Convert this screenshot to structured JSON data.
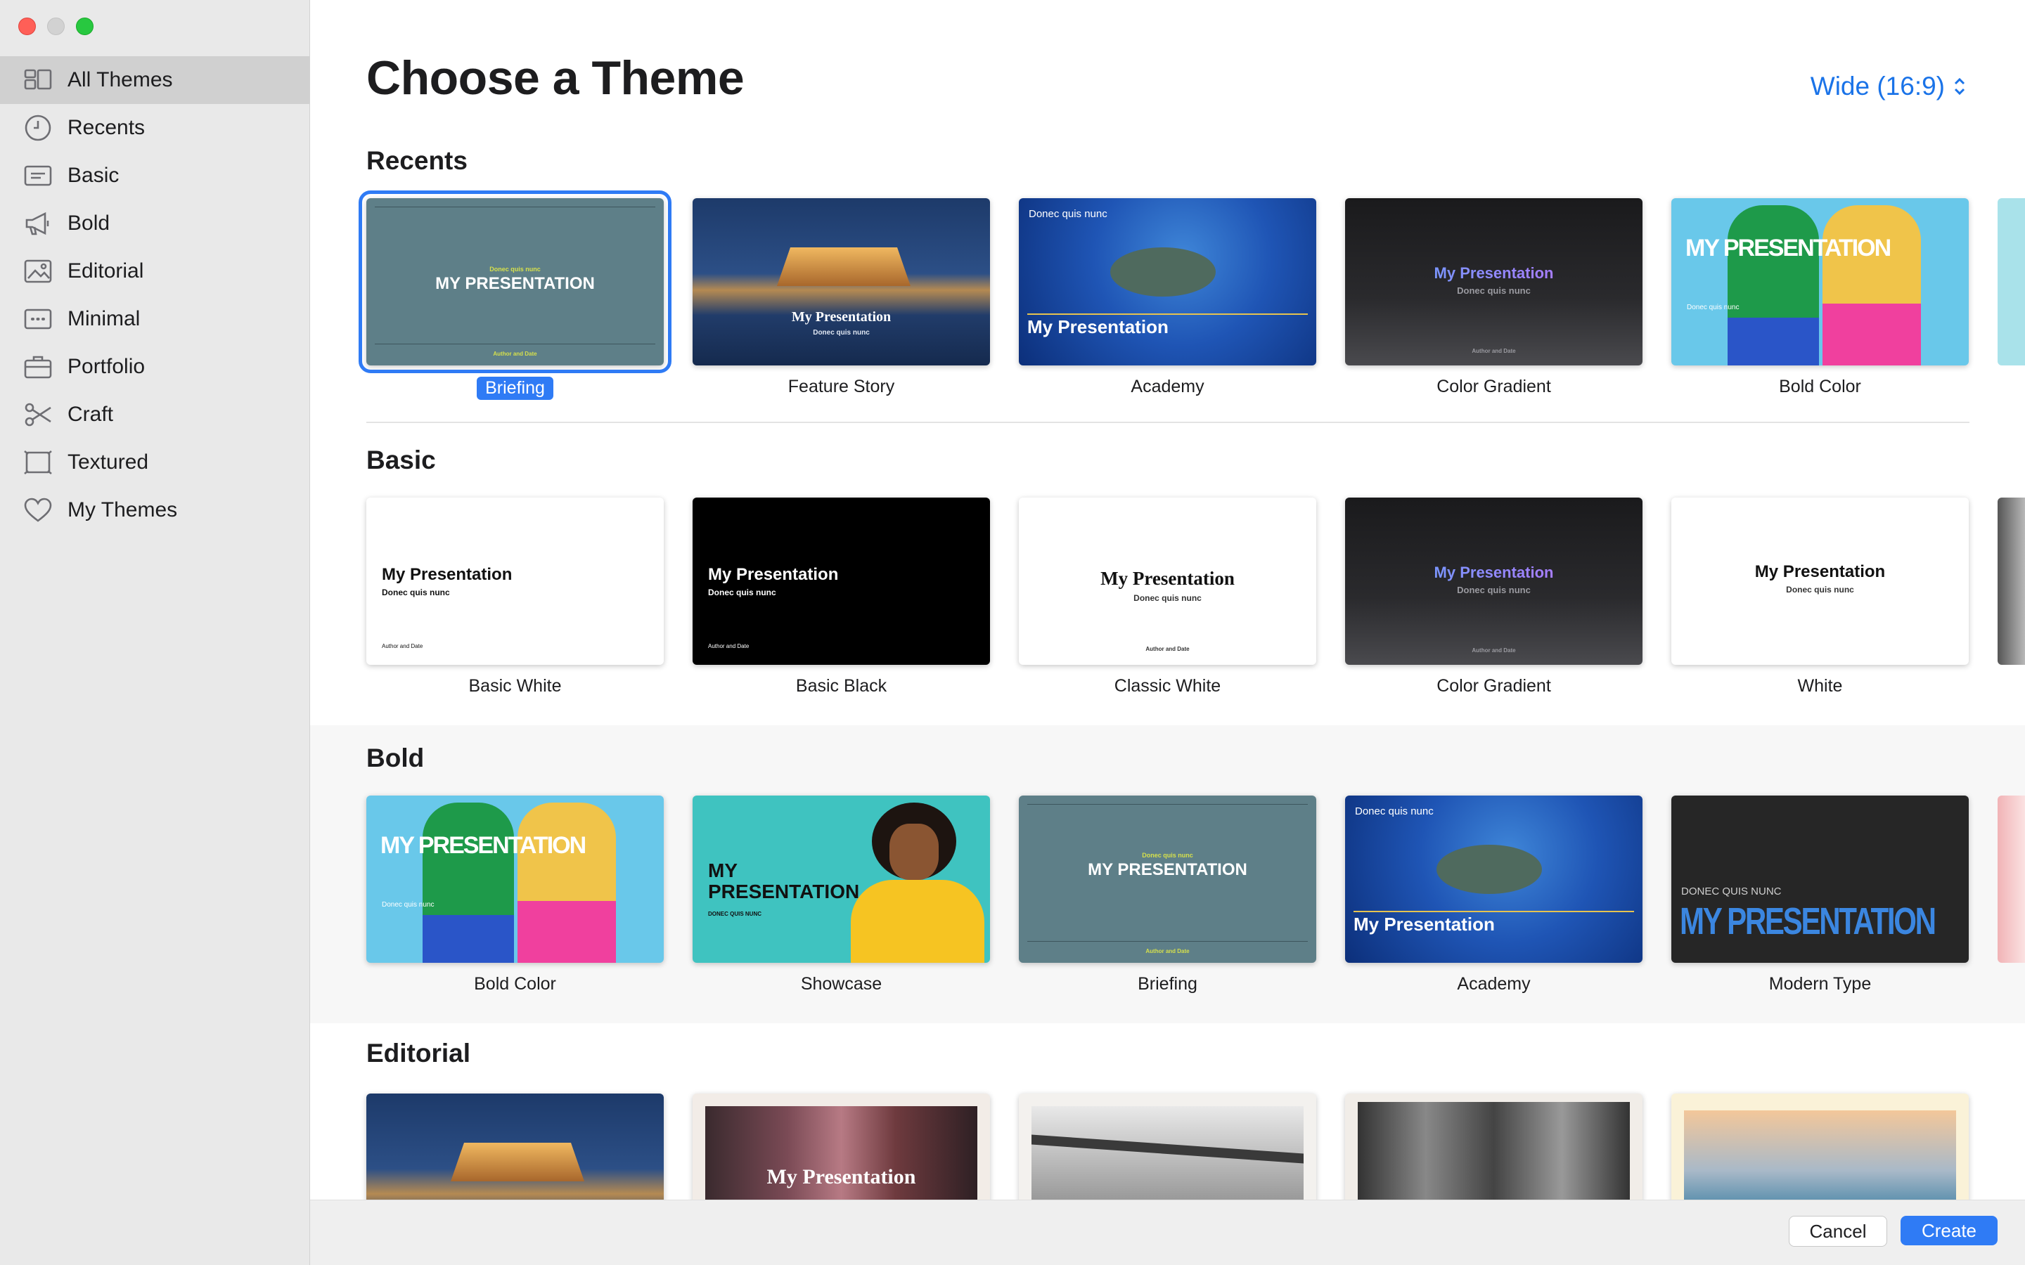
{
  "sidebar": {
    "items": [
      {
        "label": "All Themes",
        "icon": "all-themes-icon"
      },
      {
        "label": "Recents",
        "icon": "clock-icon"
      },
      {
        "label": "Basic",
        "icon": "basic-icon"
      },
      {
        "label": "Bold",
        "icon": "megaphone-icon"
      },
      {
        "label": "Editorial",
        "icon": "photo-icon"
      },
      {
        "label": "Minimal",
        "icon": "ellipsis-box-icon"
      },
      {
        "label": "Portfolio",
        "icon": "briefcase-icon"
      },
      {
        "label": "Craft",
        "icon": "scissors-icon"
      },
      {
        "label": "Textured",
        "icon": "textured-frame-icon"
      },
      {
        "label": "My Themes",
        "icon": "heart-icon"
      }
    ],
    "selected": "All Themes"
  },
  "header": {
    "title": "Choose a Theme",
    "aspect": "Wide (16:9)"
  },
  "sections": {
    "recents": {
      "title": "Recents",
      "themes": [
        {
          "name": "Briefing",
          "selected": true,
          "thumb_title": "MY PRESENTATION",
          "thumb_sub": "Donec quis nunc",
          "thumb_footer": "Author and Date"
        },
        {
          "name": "Feature Story",
          "thumb_title": "My Presentation",
          "thumb_sub": "Donec quis nunc"
        },
        {
          "name": "Academy",
          "thumb_title": "My Presentation",
          "thumb_sub": "Donec quis nunc"
        },
        {
          "name": "Color Gradient",
          "thumb_title": "My Presentation",
          "thumb_sub": "Donec quis nunc",
          "thumb_footer": "Author and Date"
        },
        {
          "name": "Bold Color",
          "thumb_title": "MY PRESENTATION",
          "thumb_sub": "Donec quis nunc"
        }
      ]
    },
    "basic": {
      "title": "Basic",
      "themes": [
        {
          "name": "Basic White",
          "thumb_title": "My Presentation",
          "thumb_sub": "Donec quis nunc",
          "thumb_footer": "Author and Date"
        },
        {
          "name": "Basic Black",
          "thumb_title": "My Presentation",
          "thumb_sub": "Donec quis nunc",
          "thumb_footer": "Author and Date"
        },
        {
          "name": "Classic White",
          "thumb_title": "My Presentation",
          "thumb_sub": "Donec quis nunc",
          "thumb_footer": "Author and Date"
        },
        {
          "name": "Color Gradient",
          "thumb_title": "My Presentation",
          "thumb_sub": "Donec quis nunc",
          "thumb_footer": "Author and Date"
        },
        {
          "name": "White",
          "thumb_title": "My Presentation",
          "thumb_sub": "Donec quis nunc"
        }
      ]
    },
    "bold": {
      "title": "Bold",
      "themes": [
        {
          "name": "Bold Color",
          "thumb_title": "MY PRESENTATION",
          "thumb_sub": "Donec quis nunc"
        },
        {
          "name": "Showcase",
          "thumb_title": "MY PRESENTATION",
          "thumb_sub": "DONEC QUIS NUNC"
        },
        {
          "name": "Briefing",
          "thumb_title": "MY PRESENTATION",
          "thumb_sub": "Donec quis nunc",
          "thumb_footer": "Author and Date"
        },
        {
          "name": "Academy",
          "thumb_title": "My Presentation",
          "thumb_sub": "Donec quis nunc"
        },
        {
          "name": "Modern Type",
          "thumb_title": "MY PRESENTATION",
          "thumb_sub": "DONEC QUIS NUNC"
        }
      ]
    },
    "editorial": {
      "title": "Editorial",
      "themes": [
        {
          "name": "",
          "thumb_title": ""
        },
        {
          "name": "",
          "thumb_title": "My Presentation"
        },
        {
          "name": "",
          "thumb_title": ""
        },
        {
          "name": "",
          "thumb_title": ""
        },
        {
          "name": "",
          "thumb_title": ""
        }
      ]
    }
  },
  "footer": {
    "cancel": "Cancel",
    "create": "Create"
  },
  "colors": {
    "accent": "#2f7bf5",
    "sidebar_bg": "#e9e9e9",
    "selected_row": "#d0d0d0"
  }
}
